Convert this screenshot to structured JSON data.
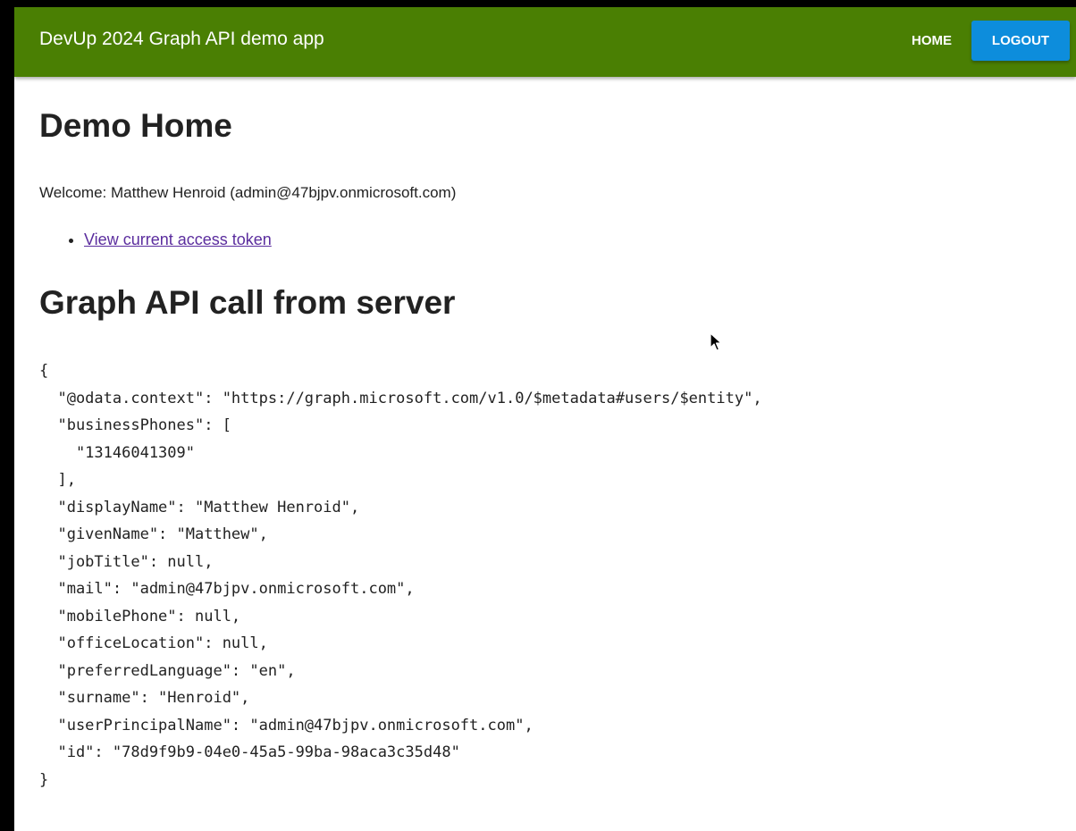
{
  "header": {
    "title": "DevUp 2024 Graph API demo app",
    "home_label": "HOME",
    "logout_label": "LOGOUT"
  },
  "main": {
    "page_title": "Demo Home",
    "welcome_text": "Welcome: Matthew Henroid (admin@47bjpv.onmicrosoft.com)",
    "links": [
      {
        "label": "View current access token"
      }
    ],
    "section_title": "Graph API call from server",
    "json_lines": [
      "{",
      "  \"@odata.context\": \"https://graph.microsoft.com/v1.0/$metadata#users/$entity\",",
      "  \"businessPhones\": [",
      "    \"13146041309\"",
      "  ],",
      "  \"displayName\": \"Matthew Henroid\",",
      "  \"givenName\": \"Matthew\",",
      "  \"jobTitle\": null,",
      "  \"mail\": \"admin@47bjpv.onmicrosoft.com\",",
      "  \"mobilePhone\": null,",
      "  \"officeLocation\": null,",
      "  \"preferredLanguage\": \"en\",",
      "  \"surname\": \"Henroid\",",
      "  \"userPrincipalName\": \"admin@47bjpv.onmicrosoft.com\",",
      "  \"id\": \"78d9f9b9-04e0-45a5-99ba-98aca3c35d48\"",
      "}"
    ]
  },
  "colors": {
    "appbar": "#4a7f03",
    "logout_button": "#0d8ddc",
    "link": "#5b2d9e"
  }
}
